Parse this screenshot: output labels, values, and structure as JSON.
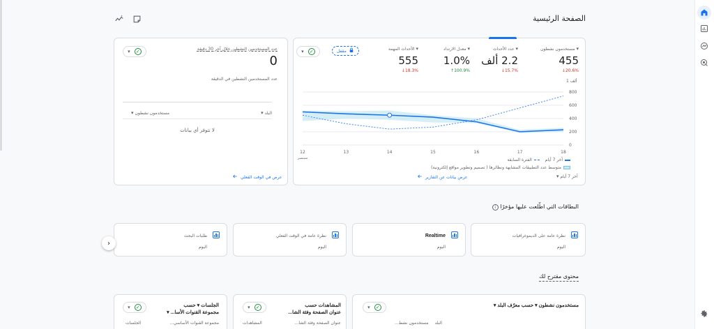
{
  "page": {
    "title": "الصفحة الرئيسية"
  },
  "main_card": {
    "metrics": [
      {
        "label": "مستخدمون نشطون",
        "value": "455",
        "change": "20.6%",
        "direction": "down"
      },
      {
        "label": "عدد الأحداث",
        "value": "2.2 ألف",
        "change": "15.7%",
        "direction": "down"
      },
      {
        "label": "معدل الارتداد",
        "value": "1.0%",
        "change": "100.9%",
        "direction": "up"
      },
      {
        "label": "الأحداث المهمة",
        "value": "555",
        "change": "18.3%",
        "direction": "down"
      }
    ],
    "lock_label": "مقفل",
    "x_ticks": [
      "18",
      "17",
      "16",
      "15",
      "14",
      "13",
      "12"
    ],
    "x_month": "سبتمبر",
    "y_unit": "1 ألف",
    "y_ticks": [
      "800",
      "600",
      "400",
      "200",
      "0"
    ],
    "legend_last7": "آخر 7 أيام",
    "legend_previous": "الفترة السابقة",
    "legend_benchmark": "متوسط عدد التطبيقات المشابهة ونظائرها ( تصميم وتطوير مواقع إلكترونية)",
    "date_range": "آخر 7 أيام",
    "view_link": "عرض بيانات عن التقارير"
  },
  "chart_data": {
    "type": "line",
    "x": [
      "12",
      "13",
      "14",
      "15",
      "16",
      "17",
      "18"
    ],
    "ylim": [
      0,
      800
    ],
    "series": [
      {
        "name": "آخر 7 أيام",
        "values": [
          500,
          470,
          450,
          420,
          350,
          200,
          230
        ]
      },
      {
        "name": "الفترة السابقة",
        "values": [
          450,
          320,
          240,
          270,
          380,
          560,
          740
        ]
      }
    ]
  },
  "realtime_card": {
    "title": "عدد المستخدمين النشطين خلال آخر 30 دقيقة",
    "value": "0",
    "per_minute": "عدد المستخدمين النشطين في الدقيقة",
    "col_country": "البلد",
    "col_users": "مستخدمون نشطون",
    "empty": "لا تتوفر أي بيانات",
    "link": "عرض في الوقت الفعلي"
  },
  "recent": {
    "title": "البطاقات التي اطّلعت عليها مؤخرًا",
    "cards": [
      {
        "title": "نظرة عامة على الديموغرافيات",
        "sub": "اليوم",
        "bold": false
      },
      {
        "title": "Realtime",
        "sub": "اليوم",
        "bold": true
      },
      {
        "title": "نظرة عامة في الوقت الفعلي",
        "sub": "اليوم",
        "bold": false
      },
      {
        "title": "طلبات البحث",
        "sub": "اليوم",
        "bold": false
      }
    ]
  },
  "suggested": {
    "title": "محتوى مقترح لك",
    "cards": [
      {
        "title": "مستخدمون نشطون ▾ حسب معرّف البلد ▾",
        "col_right": "البلد",
        "col_left": "مستخدمون نشط..."
      },
      {
        "title": "المشاهدات حسب",
        "title2": "عنوان الصفحة وفئة الشا...",
        "col_right": "عنوان الصفحة وفئة الشا...",
        "col_left": "المشاهدات"
      },
      {
        "title": "الجلسات ▾ حسب",
        "title2": "مجموعة القنوات الأسا... ▾",
        "col_right": "مجموعة القنوات الأساسي...",
        "col_left": "الجلسات"
      }
    ]
  }
}
